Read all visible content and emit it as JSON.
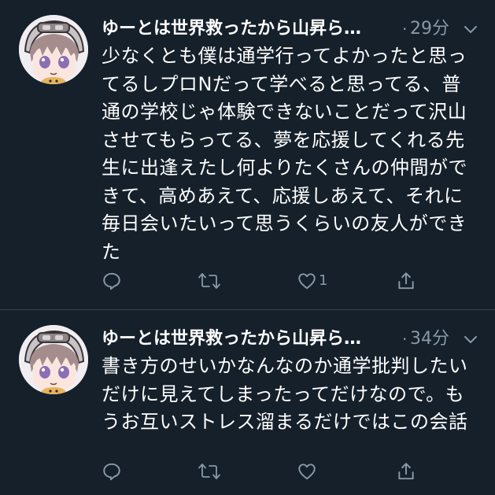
{
  "colors": {
    "background": "#15202b",
    "divider": "#38444d",
    "text_primary": "#ffffff",
    "text_secondary": "#8899a6"
  },
  "tweets": [
    {
      "display_name": "ゆーとは世界救ったから山昇ら…",
      "separator": "·",
      "timestamp": "29分",
      "body": "少なくとも僕は通学行ってよかったと思ってるしプロNだって学べると思ってる、普通の学校じゃ体験できないことだって沢山させてもらってる、夢を応援してくれる先生に出逢えたし何よりたくさんの仲間ができて、高めあえて、応援しあえて、それに毎日会いたいって思うくらいの友人ができた",
      "icons": {
        "reply": "reply-icon",
        "retweet": "retweet-icon",
        "like": "like-icon",
        "share": "share-icon",
        "menu": "chevron-down-icon"
      },
      "like_count": "1"
    },
    {
      "display_name": "ゆーとは世界救ったから山昇ら…",
      "separator": "·",
      "timestamp": "34分",
      "body": "書き方のせいかなんなのか通学批判したいだけに見えてしまったってだけなので。もうお互いストレス溜まるだけではこの会話",
      "icons": {
        "reply": "reply-icon",
        "retweet": "retweet-icon",
        "like": "like-icon",
        "share": "share-icon",
        "menu": "chevron-down-icon"
      },
      "like_count": ""
    }
  ]
}
